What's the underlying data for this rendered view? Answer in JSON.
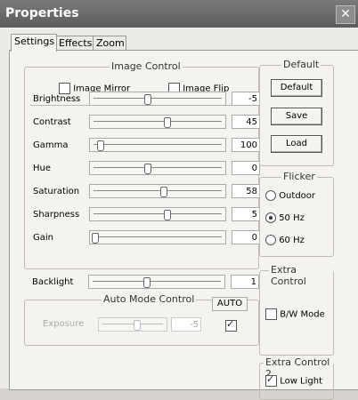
{
  "window": {
    "title": "Properties",
    "close_glyph": "✕"
  },
  "tabs": [
    {
      "label": "Settings",
      "active": true
    },
    {
      "label": "Effects",
      "active": false
    },
    {
      "label": "Zoom",
      "active": false
    }
  ],
  "image_control": {
    "title": "Image Control",
    "mirror_label": "Image Mirror",
    "mirror_checked": false,
    "flip_label": "Image Flip",
    "flip_checked": false,
    "sliders": [
      {
        "label": "Brightness",
        "value": "-5",
        "level": 0.42
      },
      {
        "label": "Contrast",
        "value": "45",
        "level": 0.58
      },
      {
        "label": "Gamma",
        "value": "100",
        "level": 0.04
      },
      {
        "label": "Hue",
        "value": "0",
        "level": 0.42
      },
      {
        "label": "Saturation",
        "value": "58",
        "level": 0.55
      },
      {
        "label": "Sharpness",
        "value": "5",
        "level": 0.58
      },
      {
        "label": "Gain",
        "value": "0",
        "level": 0.0
      }
    ]
  },
  "backlight": {
    "label": "Backlight",
    "value": "1",
    "level": 0.42
  },
  "auto_mode": {
    "title": "Auto Mode Control",
    "auto_label": "AUTO",
    "auto_checked": true,
    "exposure_label": "Exposure",
    "exposure_value": "-5",
    "exposure_level": 0.6
  },
  "default_group": {
    "title": "Default",
    "default_btn": "Default",
    "save_btn": "Save",
    "load_btn": "Load"
  },
  "flicker": {
    "title": "Flicker",
    "options": [
      {
        "label": "Outdoor",
        "selected": false
      },
      {
        "label": "50 Hz",
        "selected": true
      },
      {
        "label": "60 Hz",
        "selected": false
      }
    ]
  },
  "extra_control": {
    "title": "Extra Control",
    "bw_label": "B/W Mode",
    "bw_checked": false
  },
  "extra_control2": {
    "title": "Extra Control 2",
    "lowlight_label": "Low Light",
    "lowlight_checked": true
  }
}
